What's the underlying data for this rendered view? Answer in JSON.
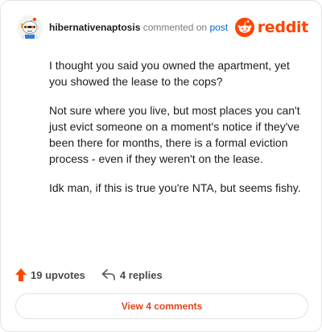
{
  "header": {
    "username": "hibernativenaptosis",
    "action": "commented on",
    "post_link": "post",
    "brand": "reddit",
    "brand_color": "#ff4500"
  },
  "comment": {
    "paragraphs": [
      "I thought you said you owned the apartment, yet you showed the lease to the cops?",
      "Not sure where you live, but most places you can't just evict someone on a moment's notice if they've been there for months, there is a formal eviction process - even if they weren't on the lease.",
      "Idk man, if this is true you're NTA, but seems fishy."
    ]
  },
  "footer": {
    "upvotes": "19 upvotes",
    "replies": "4 replies",
    "upvote_icon": "arrow-up-icon",
    "reply_icon": "reply-icon"
  },
  "view_button": {
    "label": "View 4 comments"
  }
}
